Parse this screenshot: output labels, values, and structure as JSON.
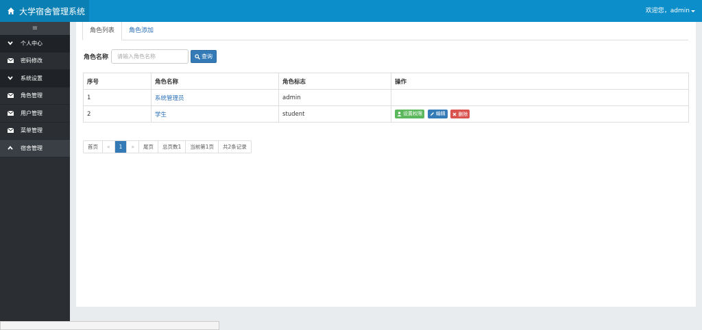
{
  "header": {
    "title": "大学宿舍管理系统",
    "welcome": "欢迎您，admin"
  },
  "sidebar": {
    "toggle": "≡",
    "items": [
      {
        "label": "个人中心",
        "icon": "chevron-down-icon"
      },
      {
        "label": "密码修改",
        "icon": "envelope-icon"
      },
      {
        "label": "系统设置",
        "icon": "chevron-down-icon"
      },
      {
        "label": "角色管理",
        "icon": "envelope-icon"
      },
      {
        "label": "用户管理",
        "icon": "envelope-icon"
      },
      {
        "label": "菜单管理",
        "icon": "envelope-icon"
      },
      {
        "label": "宿舍管理",
        "icon": "chevron-up-icon"
      }
    ]
  },
  "tabs": [
    {
      "label": "角色列表"
    },
    {
      "label": "角色添加"
    }
  ],
  "search": {
    "label": "角色名称",
    "placeholder": "请输入角色名称",
    "button": "查询"
  },
  "table": {
    "headers": [
      "序号",
      "角色名称",
      "角色标志",
      "操作"
    ],
    "rows": [
      {
        "no": "1",
        "name": "系统管理员",
        "flag": "admin"
      },
      {
        "no": "2",
        "name": "学生",
        "flag": "student"
      }
    ],
    "actions": {
      "permission": "设置权限",
      "edit": "编辑",
      "delete": "删除"
    }
  },
  "pager": {
    "first": "首页",
    "prev": "«",
    "current": "1",
    "next": "»",
    "last": "尾页",
    "total_pages": "总页数1",
    "current_page": "当前第1页",
    "total_records": "共2条记录"
  },
  "colors": {
    "header": "#0b8ec9",
    "sidebar": "#2b2f33",
    "primary": "#337ab7",
    "success": "#5cb85c",
    "danger": "#d9534f"
  }
}
